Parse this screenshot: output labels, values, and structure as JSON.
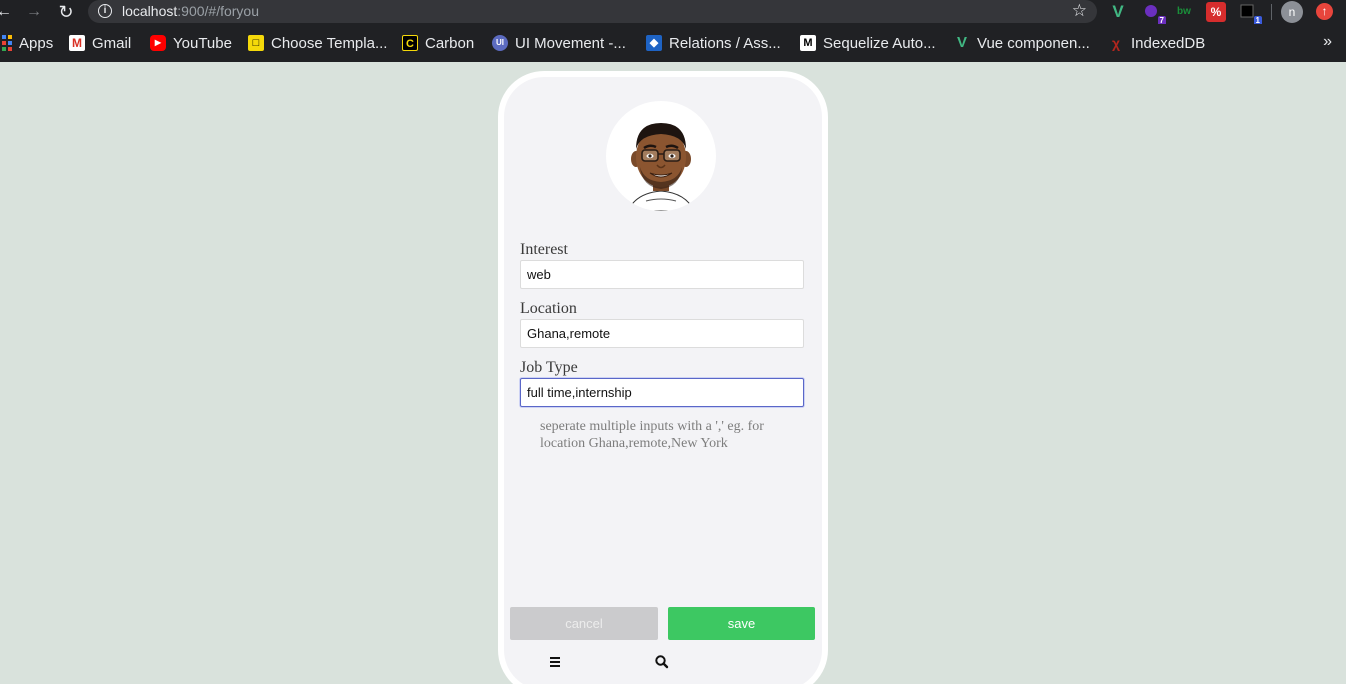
{
  "browser": {
    "url_host": "localhost",
    "url_path": ":900/#/foryou",
    "extensions": [
      {
        "name": "vue-devtools",
        "glyph": "V",
        "color": "#41b883"
      },
      {
        "name": "extension-purple",
        "glyph": "",
        "color": "#6b2fbf",
        "badge": "7"
      },
      {
        "name": "extension-bw",
        "glyph": "bw",
        "color": "#1a8f3a"
      },
      {
        "name": "extension-red",
        "glyph": "%",
        "color": "#d62d2d"
      },
      {
        "name": "extension-box",
        "glyph": "",
        "color": "#333",
        "badge": "1"
      }
    ],
    "profile_initial": "n"
  },
  "bookmarks": [
    {
      "label": "Apps",
      "icon": "apps-grid-icon"
    },
    {
      "label": "Gmail",
      "icon": "gmail-icon"
    },
    {
      "label": "YouTube",
      "icon": "youtube-icon"
    },
    {
      "label": "Choose Templa...",
      "icon": "template-icon"
    },
    {
      "label": "Carbon",
      "icon": "carbon-icon"
    },
    {
      "label": "UI Movement -...",
      "icon": "ui-movement-icon"
    },
    {
      "label": "Relations / Ass...",
      "icon": "relations-icon"
    },
    {
      "label": "Sequelize Auto...",
      "icon": "medium-icon"
    },
    {
      "label": "Vue componen...",
      "icon": "vue-icon"
    },
    {
      "label": "IndexedDB",
      "icon": "indexeddb-icon"
    }
  ],
  "form": {
    "interest_label": "Interest",
    "interest_value": "web",
    "location_label": "Location",
    "location_value": "Ghana,remote",
    "jobtype_label": "Job Type",
    "jobtype_value": "full time,internship",
    "hint": "seperate multiple inputs with a ',' eg. for location Ghana,remote,New York"
  },
  "buttons": {
    "cancel": "cancel",
    "save": "save"
  },
  "colors": {
    "page_bg": "#d9e2dc",
    "save": "#3dc862",
    "cancel": "#cbcbcd"
  }
}
